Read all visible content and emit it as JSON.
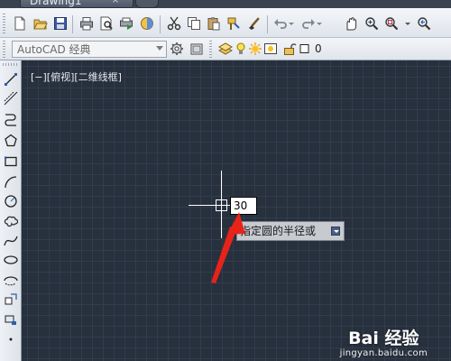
{
  "tabstrip": {
    "document_tab": "Drawing1",
    "close_glyph": "×"
  },
  "toolbar": {
    "buttons": [
      "new-icon",
      "open-icon",
      "save-icon",
      "print-icon",
      "print-preview-icon",
      "publish-icon",
      "3d-print-icon",
      "cut-icon",
      "copy-icon",
      "paste-icon",
      "match-properties-icon",
      "brush-icon",
      "undo-icon",
      "redo-icon",
      "pan-icon",
      "zoom-realtime-icon",
      "zoom-window-icon",
      "zoom-previous-icon"
    ],
    "workspace": "AutoCAD 经典",
    "layer": "0"
  },
  "canvas": {
    "viewport_label": "[−][俯视][二维线框]",
    "dynamic_input_value": "30",
    "command_prompt": "指定圆的半径或"
  },
  "watermark": {
    "logo": "Bai 经验",
    "url": "jingyan.baidu.com"
  },
  "colors": {
    "canvas": "#27303d",
    "grid": "#323c4b",
    "annotation_arrow": "#e8231a"
  }
}
